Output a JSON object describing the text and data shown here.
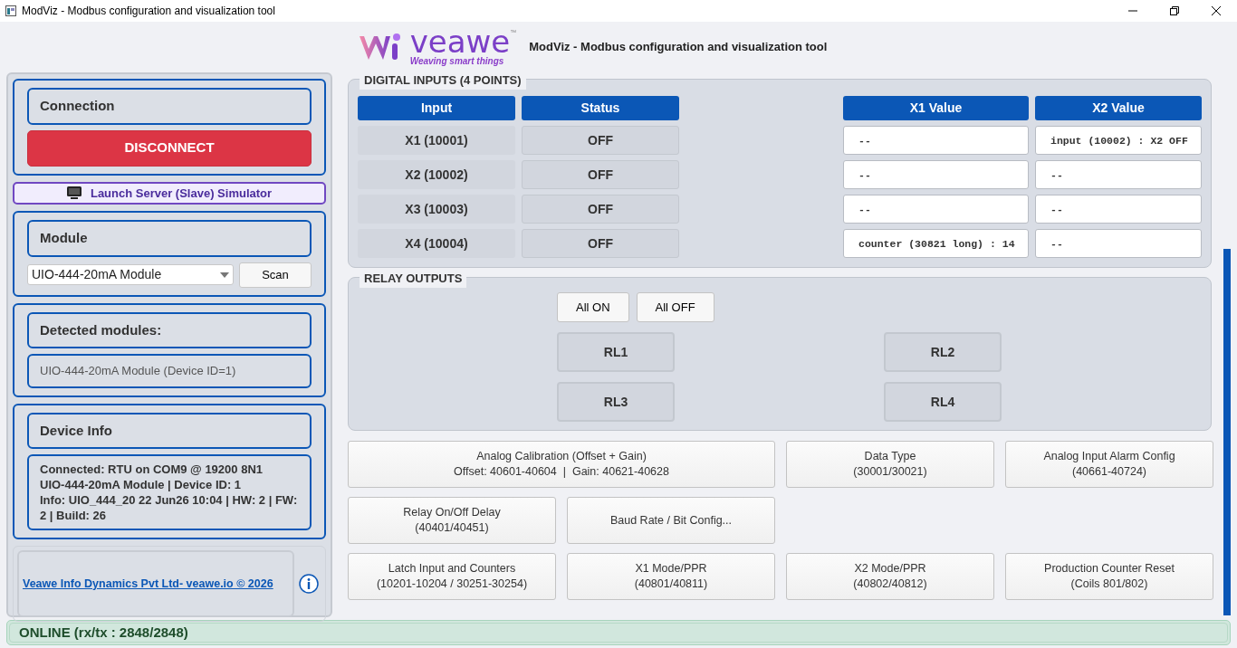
{
  "window": {
    "title": "ModViz - Modbus configuration and visualization tool"
  },
  "header": {
    "wordmark": "veawe",
    "trademark": "™",
    "tagline": "Weaving smart things",
    "title": "ModViz - Modbus configuration and visualization tool"
  },
  "connection": {
    "heading": "Connection",
    "button": "DISCONNECT"
  },
  "simulator_button": "Launch Server (Slave) Simulator",
  "module": {
    "heading": "Module",
    "value": "UIO-444-20mA Module",
    "scan_button": "Scan"
  },
  "detected": {
    "heading": "Detected modules:",
    "items": [
      "UIO-444-20mA Module (Device ID=1)"
    ]
  },
  "device_info": {
    "heading": "Device Info",
    "lines": [
      "Connected: RTU on COM9 @ 19200 8N1",
      "UIO-444-20mA Module | Device ID: 1",
      "Info: UIO_444_20 22 Jun26 10:04 | HW: 2 | FW: 2 | Build: 26"
    ]
  },
  "footer": {
    "link": "Veawe Info Dynamics Pvt Ltd- veawe.io © 2026"
  },
  "digital_inputs": {
    "title": "DIGITAL INPUTS (4 POINTS)",
    "columns": [
      "Input",
      "Status",
      "X1 Value",
      "X2 Value"
    ],
    "rows": [
      {
        "input": "X1 (10001)",
        "status": "OFF",
        "on": false,
        "x1_value": "--",
        "x2_value": "input (10002) : X2 OFF"
      },
      {
        "input": "X2 (10002)",
        "status": "OFF",
        "on": false,
        "x1_value": "--",
        "x2_value": "--"
      },
      {
        "input": "X3 (10003)",
        "status": "OFF",
        "on": false,
        "x1_value": "--",
        "x2_value": "--"
      },
      {
        "input": "X4 (10004)",
        "status": "OFF",
        "on": false,
        "x1_value": "counter (30821 long) : 14",
        "x2_value": "--"
      }
    ]
  },
  "relay_outputs": {
    "title": "RELAY OUTPUTS",
    "buttons": [
      "All ON",
      "All OFF"
    ],
    "relays": [
      {
        "label": "RL1",
        "on": false
      },
      {
        "label": "RL2",
        "on": false
      },
      {
        "label": "RL3",
        "on": false
      },
      {
        "label": "RL4",
        "on": false
      }
    ]
  },
  "actions": [
    [
      "Analog Calibration (Offset + Gain)\nOffset: 40601-40604  |  Gain: 40621-40628",
      "Data Type\n(30001/30021)",
      "Analog Input Alarm Config\n(40661-40724)"
    ],
    [
      "Relay On/Off Delay\n(40401/40451)",
      "Baud Rate / Bit Config..."
    ],
    [
      "Latch Input and Counters\n(10201-10204 / 30251-30254)",
      "X1 Mode/PPR\n(40801/40811)",
      "X2 Mode/PPR\n(40802/40812)",
      "Production Counter Reset\n(Coils 801/802)"
    ]
  ],
  "status_bar": "ONLINE (rx/tx : 2848/2848)"
}
